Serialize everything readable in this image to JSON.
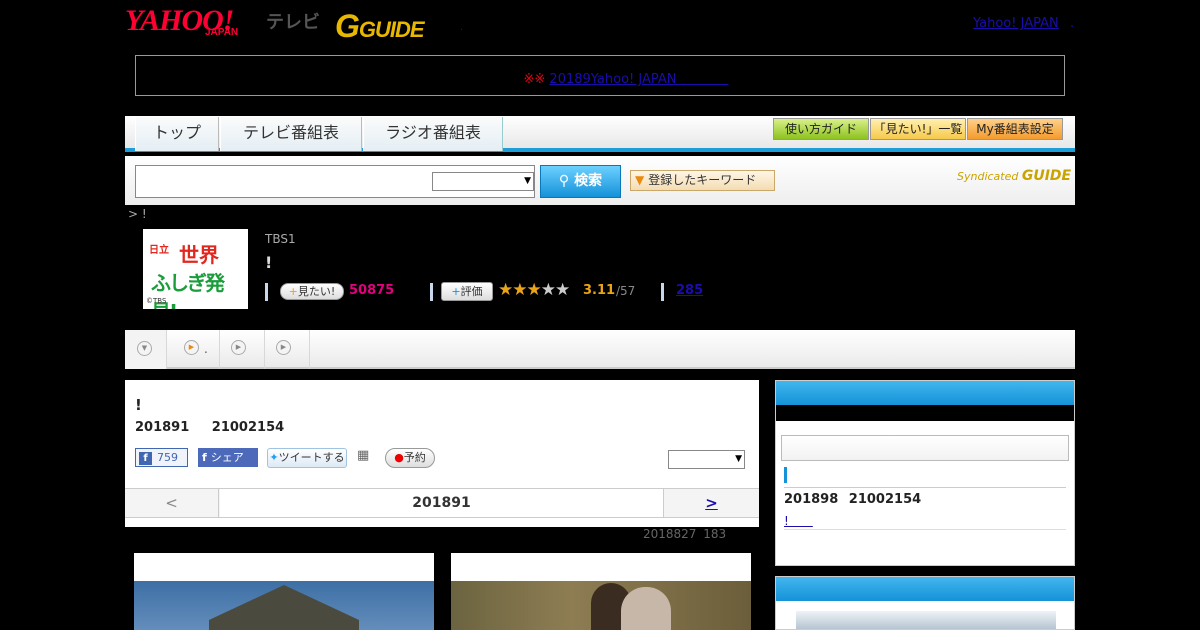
{
  "header": {
    "logo_yahoo": "YAHOO!",
    "logo_japan": "JAPAN",
    "logo_tv": "テレビ",
    "logo_gguide_g": "G",
    "logo_gguide_rest": "GUIDE",
    "yahoo_japan_link": "Yahoo! JAPAN",
    "dot": ".",
    "small_dot": "."
  },
  "notice": {
    "mark": "※※",
    "text": "20189Yahoo! JAPAN　　　　"
  },
  "nav": {
    "tabs": [
      {
        "label": "トップ"
      },
      {
        "label": "テレビ番組表"
      },
      {
        "label": "ラジオ番組表"
      }
    ],
    "buttons": {
      "guide": "使い方ガイド",
      "mitai_list": "「見たい!」一覧",
      "my_settings": "My番組表設定"
    },
    "accent_color": "#1e9ed6"
  },
  "search": {
    "input_value": "",
    "select_value": "",
    "button_label": "検索",
    "keyword_button": "登録したキーワード",
    "syndicated_label": "Syndicated",
    "syndicated_logo": "GUIDE"
  },
  "breadcrumb": "> !",
  "program": {
    "image_text": {
      "maker": "日立",
      "title1": "世界",
      "title2": "ふしぎ発見!",
      "copyright": "©TBS"
    },
    "channel": "TBS1",
    "title": "!",
    "mitai_label": "見たい!",
    "mitai_count": "50875",
    "hyoka_label": "評価",
    "stars_filled": 3,
    "stars_total": 5,
    "rating": "3.11",
    "rating_total": "/57",
    "review_count": "285",
    "rating_color": "#e9a417",
    "mitai_color": "#e3007f"
  },
  "subtabs": [
    {
      "label": "",
      "icon": "chevron-down-icon"
    },
    {
      "label": ".",
      "icon": "play-icon"
    },
    {
      "label": "",
      "icon": "play-icon"
    },
    {
      "label": "",
      "icon": "play-icon"
    }
  ],
  "episode": {
    "title": "!",
    "date": "201891 21002154",
    "fb_like_count": "759",
    "fb_share_label": "シェア",
    "tweet_label": "ツイートする",
    "reserve_label": "予約",
    "select_value": "",
    "pager_prev": "<",
    "pager_current": "201891",
    "pager_next": ">",
    "sub_info": "2018827 183"
  },
  "sidebar": {
    "next_date": "201898 21002154",
    "next_link": "!　　"
  }
}
